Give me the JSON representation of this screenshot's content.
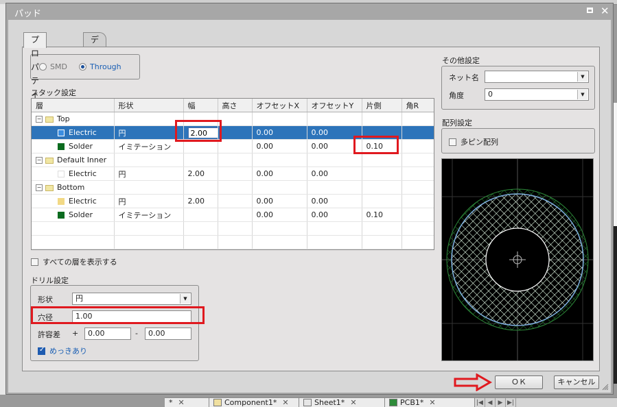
{
  "dialog": {
    "title": "パッド",
    "tabs": [
      {
        "label": "プロパティ",
        "active": true
      },
      {
        "label": "デザインルール",
        "active": false
      }
    ],
    "pad_type": {
      "options": [
        "SMD",
        "Through"
      ],
      "selected": "Through"
    },
    "stack": {
      "section_label": "スタック設定",
      "columns": [
        "層",
        "形状",
        "幅",
        "高さ",
        "オフセットX",
        "オフセットY",
        "片側",
        "角R"
      ],
      "rows": [
        {
          "kind": "group",
          "name": "Top"
        },
        {
          "kind": "layer",
          "name": "Electric",
          "swatch": "#3a8de0",
          "shape": "円",
          "width": "2.00",
          "height": "",
          "offset_x": "0.00",
          "offset_y": "0.00",
          "side": "",
          "corner": "",
          "selected": true
        },
        {
          "kind": "layer",
          "name": "Solder",
          "swatch": "#0b6b1f",
          "shape": "イミテーション",
          "width": "",
          "height": "",
          "offset_x": "0.00",
          "offset_y": "0.00",
          "side": "0.10",
          "corner": ""
        },
        {
          "kind": "group",
          "name": "Default Inner"
        },
        {
          "kind": "layer",
          "name": "Electric",
          "swatch": "#ffffff",
          "shape": "円",
          "width": "2.00",
          "height": "",
          "offset_x": "0.00",
          "offset_y": "0.00",
          "side": "",
          "corner": ""
        },
        {
          "kind": "group",
          "name": "Bottom"
        },
        {
          "kind": "layer",
          "name": "Electric",
          "swatch": "#f2d985",
          "shape": "円",
          "width": "2.00",
          "height": "",
          "offset_x": "0.00",
          "offset_y": "0.00",
          "side": "",
          "corner": ""
        },
        {
          "kind": "layer",
          "name": "Solder",
          "swatch": "#0b6b1f",
          "shape": "イミテーション",
          "width": "",
          "height": "",
          "offset_x": "0.00",
          "offset_y": "0.00",
          "side": "0.10",
          "corner": ""
        }
      ],
      "show_all_layers_label": "すべての層を表示する",
      "show_all_layers": false
    },
    "drill": {
      "section_label": "ドリル設定",
      "shape_label": "形状",
      "shape_value": "円",
      "diameter_label": "穴径",
      "diameter_value": "1.00",
      "tolerance_label": "許容差",
      "tol_plus_sign": "+",
      "tol_plus": "0.00",
      "tol_minus_sign": "-",
      "tol_minus": "0.00",
      "plated_label": "めっきあり",
      "plated": true
    },
    "other": {
      "section_label": "その他設定",
      "net_label": "ネット名",
      "net_value": "",
      "angle_label": "角度",
      "angle_value": "0"
    },
    "array": {
      "section_label": "配列設定",
      "multipin_label": "多ピン配列",
      "multipin": false
    },
    "buttons": {
      "ok": "ＯＫ",
      "cancel": "キャンセル"
    }
  },
  "background_tabs": [
    {
      "label": "*",
      "icon": ""
    },
    {
      "label": "Component1*",
      "icon": "component"
    },
    {
      "label": "Sheet1*",
      "icon": "sch"
    },
    {
      "label": "PCB1*",
      "icon": "pcb"
    }
  ],
  "colors": {
    "selection": "#2d74ba",
    "highlight": "#e0191f",
    "pad_ring": "#ffffff",
    "solder_ring": "#1f7a2c",
    "mask_outline": "#7fb0e0"
  }
}
